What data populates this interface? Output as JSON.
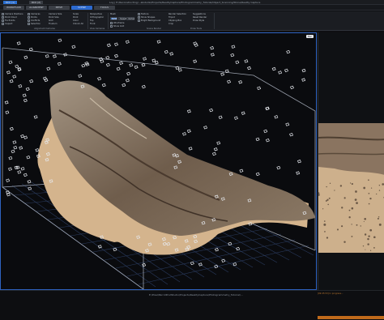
{
  "window": {
    "tabs": [
      "RC0 (1)",
      "RC0 (2)"
    ],
    "path": "Log | E:/Reconstructing/...akstudio/Projects/RealityCapture/Photogrammetry_Tutorial/Object_Scanning/Stone/Reality Capture"
  },
  "ribbon_tabs": [
    {
      "label": "WORKFLOW",
      "style": "grey"
    },
    {
      "label": "ALIGNMENT",
      "style": "grey"
    },
    {
      "label": "MESH",
      "style": "grey"
    },
    {
      "label": "SCENE",
      "style": "blue"
    },
    {
      "label": "TOOLS",
      "style": "grey"
    }
  ],
  "ribbon": {
    "col1": [
      "Camera Positions",
      "Point Cloud",
      "Tie Points",
      "Inspect",
      "Scene"
    ],
    "col2": [
      "Cameras",
      "Points",
      "Conflicts",
      "Selection"
    ],
    "col3": [
      "Camera Size",
      "Point Size",
      "Grid",
      "Frustum"
    ],
    "col4": [
      "Scale",
      "Point",
      "Color",
      "Unlock All"
    ],
    "col5": [
      "Perspective",
      "Orthographic",
      "Top",
      "Front"
    ],
    "col6": [
      "Mesh",
      "Solid",
      "Wireframe",
      "Show Grid"
    ],
    "buttons": [
      "Solid",
      "Sweet",
      "Vertex"
    ],
    "col7": [
      "Texture",
      "Show Shapes",
      "Bright Background",
      "Show Grid"
    ],
    "col8": [
      "Render Selection",
      "Tripod",
      "Clipping Box",
      "Crop"
    ],
    "col9": [
      "Suggestions",
      "Reset Render",
      "Draw Style"
    ],
    "group_labels": [
      "Alignment Cameras",
      "View Cameras",
      "Scene Render",
      "Draw Tools"
    ]
  },
  "viewport": {
    "close_label": "Esc",
    "model": "scanned driftwood stone on sand with camera frustums"
  },
  "statusbar": {
    "text": "E:/Pixel/ParrotProdStudio/Projects/RealityCapture/Photogrammetry_Tutorial/...",
    "log": "[09:45:53] In progress..."
  },
  "colors": {
    "accent": "#2c6ad0",
    "viewport_border": "#2e62c0",
    "warning": "#c06a1b"
  }
}
